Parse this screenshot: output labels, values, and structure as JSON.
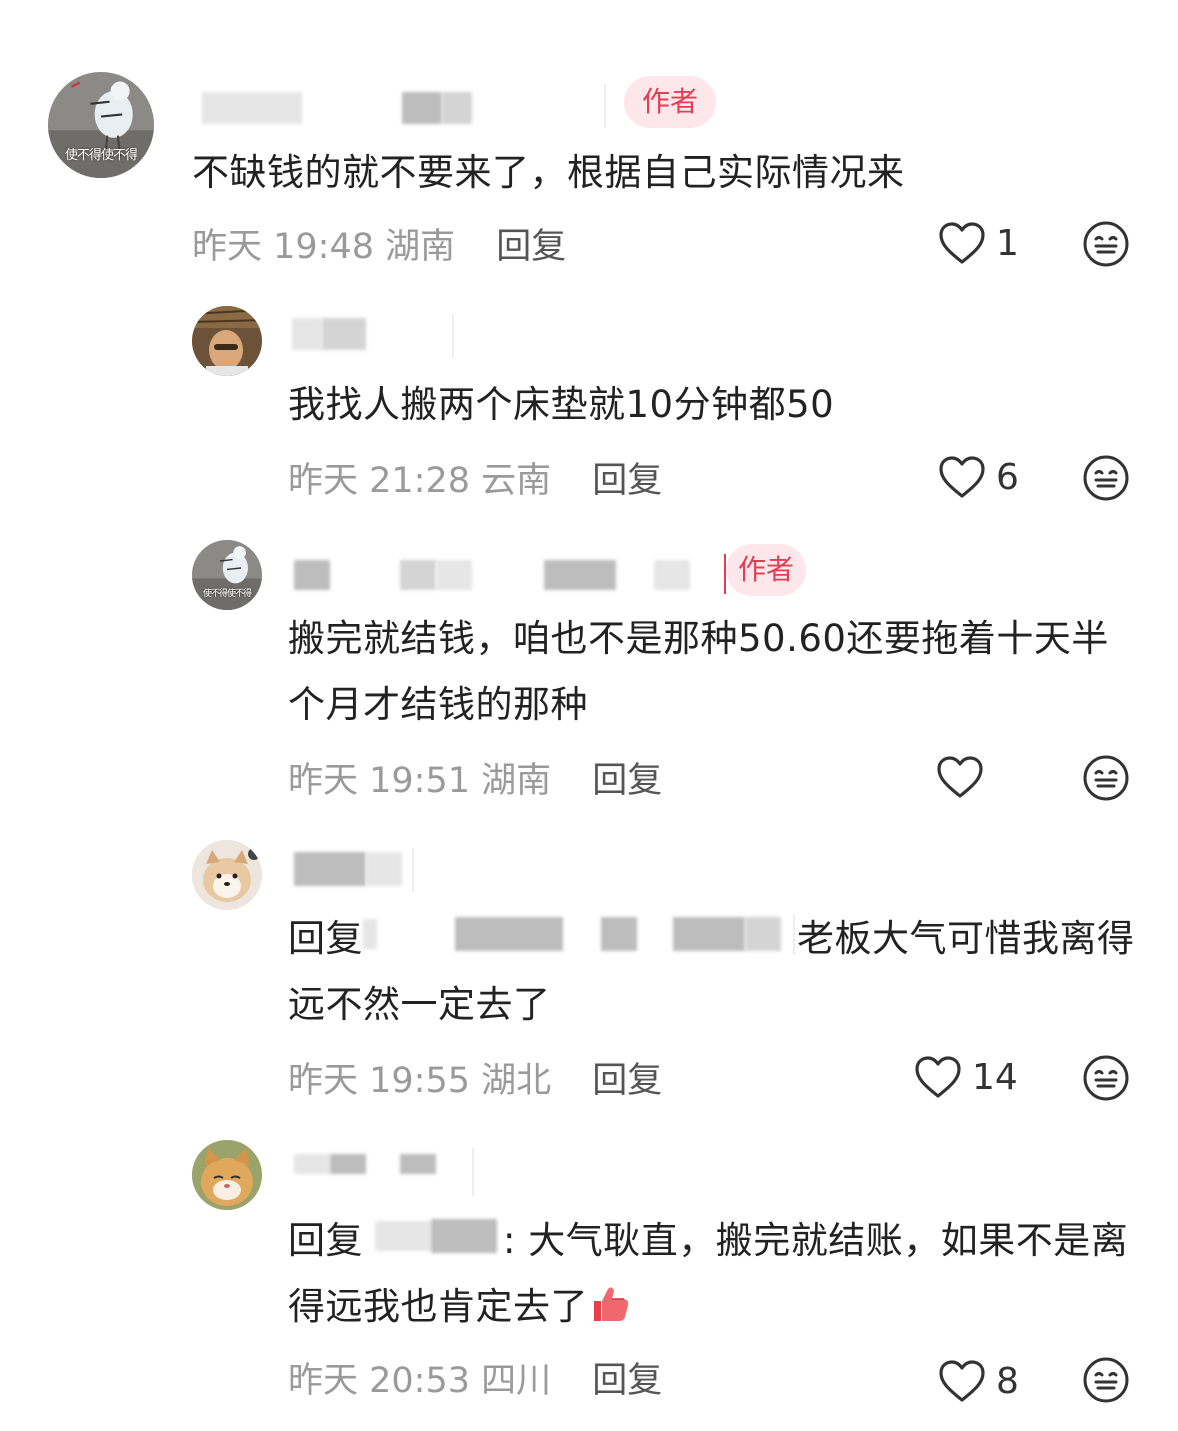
{
  "author_badge": "作者",
  "reply_label": "回复",
  "comments": [
    {
      "avatar_caption": "使不得使不得",
      "text": "不缺钱的就不要来了，根据自己实际情况来",
      "time": "昨天 19:48",
      "location": "湖南",
      "likes": "1"
    },
    {
      "text": "我找人搬两个床垫就10分钟都50",
      "time": "昨天 21:28",
      "location": "云南",
      "likes": "6"
    },
    {
      "avatar_caption": "使不得使不得",
      "text": "搬完就结钱，咱也不是那种50.60还要拖着十天半个月才结钱的那种",
      "time": "昨天 19:51",
      "location": "湖南",
      "likes": ""
    },
    {
      "reply_prefix": "回复",
      "text": "老板大气可惜我离得远不然一定去了",
      "time": "昨天 19:55",
      "location": "湖北",
      "likes": "14"
    },
    {
      "reply_prefix": "回复",
      "text": ": 大气耿直，搬完就结账，如果不是离得远我也肯定去了",
      "time": "昨天 20:53",
      "location": "四川",
      "likes": "8"
    }
  ],
  "icons": {
    "like": "heart-outline-icon",
    "emoji": "expressionless-face-icon",
    "thumbs_up": "thumbs-up-emoji"
  },
  "colors": {
    "badge_bg": "#fde7ea",
    "badge_text": "#e23d55",
    "meta_text": "#9a9a9a"
  }
}
